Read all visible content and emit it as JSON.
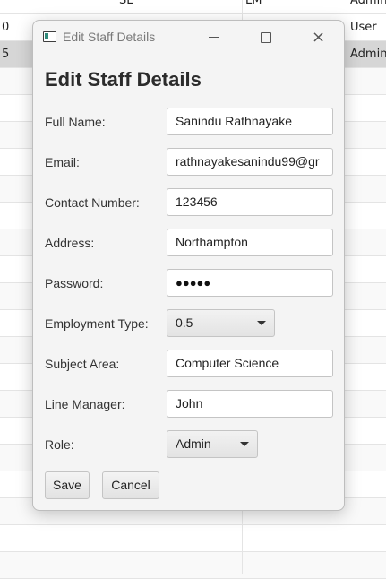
{
  "background_table": {
    "rows": [
      {
        "c1": "0",
        "c2": "",
        "c3": "",
        "c4": "User"
      },
      {
        "c1": "5",
        "c2": "",
        "c3": "",
        "c4": "Admin"
      }
    ],
    "header_partial": {
      "c2": "SE",
      "c3": "LM",
      "c4": "Admin"
    }
  },
  "window": {
    "title": "Edit Staff Details",
    "icon": "app-window-icon",
    "controls": {
      "minimize": "minimize-icon",
      "maximize": "maximize-icon",
      "close": "×"
    }
  },
  "form": {
    "heading": "Edit Staff Details",
    "full_name": {
      "label": "Full Name:",
      "value": "Sanindu Rathnayake"
    },
    "email": {
      "label": "Email:",
      "value": "rathnayakesanindu99@gr"
    },
    "contact": {
      "label": "Contact Number:",
      "value": "123456"
    },
    "address": {
      "label": "Address:",
      "value": "Northampton"
    },
    "password": {
      "label": "Password:",
      "value": "●●●●●"
    },
    "employment_type": {
      "label": "Employment Type:",
      "value": "0.5"
    },
    "subject_area": {
      "label": "Subject Area:",
      "value": "Computer Science"
    },
    "line_manager": {
      "label": "Line Manager:",
      "value": "John"
    },
    "role": {
      "label": "Role:",
      "value": "Admin"
    }
  },
  "buttons": {
    "save": "Save",
    "cancel": "Cancel"
  }
}
